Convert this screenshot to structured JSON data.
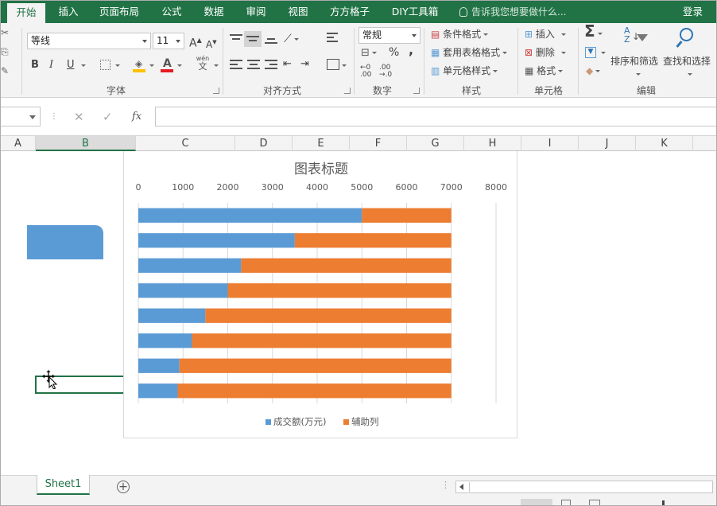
{
  "tabs": [
    {
      "label": "开始",
      "active": true
    },
    {
      "label": "插入"
    },
    {
      "label": "页面布局"
    },
    {
      "label": "公式"
    },
    {
      "label": "数据"
    },
    {
      "label": "审阅"
    },
    {
      "label": "视图"
    },
    {
      "label": "方方格子"
    },
    {
      "label": "DIY工具箱"
    }
  ],
  "tell_me": "告诉我您想要做什么...",
  "login": "登录",
  "ribbon": {
    "font": {
      "name": "等线",
      "size": "11",
      "grow_icon": "A",
      "shrink_icon": "A",
      "bold": "B",
      "italic": "I",
      "underline": "U",
      "phonetic": "wén",
      "phonetic_char": "文",
      "group_label": "字体"
    },
    "alignment": {
      "group_label": "对齐方式"
    },
    "number": {
      "format": "常规",
      "percent": "%",
      "comma": ",",
      "group_label": "数字"
    },
    "styles": {
      "conditional": "条件格式",
      "table": "套用表格格式",
      "cell_styles": "单元格样式",
      "group_label": "样式"
    },
    "cells": {
      "insert": "插入",
      "delete": "删除",
      "format": "格式",
      "group_label": "单元格"
    },
    "editing": {
      "sort_filter": "排序和筛选",
      "find_select": "查找和选择",
      "group_label": "编辑"
    }
  },
  "formula_bar": {
    "cancel": "✕",
    "enter": "✓",
    "fx": "fx"
  },
  "columns": [
    "A",
    "B",
    "C",
    "D",
    "E",
    "F",
    "G",
    "H",
    "I",
    "J",
    "K"
  ],
  "selected_column": "B",
  "sheet_tab": "Sheet1",
  "add_sheet": "+",
  "colors": {
    "ribbon_green": "#217346",
    "series1": "#5b9bd5",
    "series2": "#ed7d31"
  },
  "chart_data": {
    "type": "bar",
    "orientation": "horizontal",
    "stacked": true,
    "title": "图表标题",
    "x_ticks": [
      0,
      1000,
      2000,
      3000,
      4000,
      5000,
      6000,
      7000,
      8000
    ],
    "xlim": [
      0,
      8000
    ],
    "x_axis_position": "top",
    "grid": true,
    "legend_position": "bottom",
    "series": [
      {
        "name": "成交额(万元)",
        "color": "#5b9bd5",
        "values": [
          5000,
          3500,
          2300,
          2000,
          1500,
          1200,
          920,
          880
        ]
      },
      {
        "name": "辅助列",
        "color": "#ed7d31",
        "values": [
          2000,
          3500,
          4700,
          5000,
          5500,
          5800,
          6080,
          6120
        ]
      }
    ]
  }
}
